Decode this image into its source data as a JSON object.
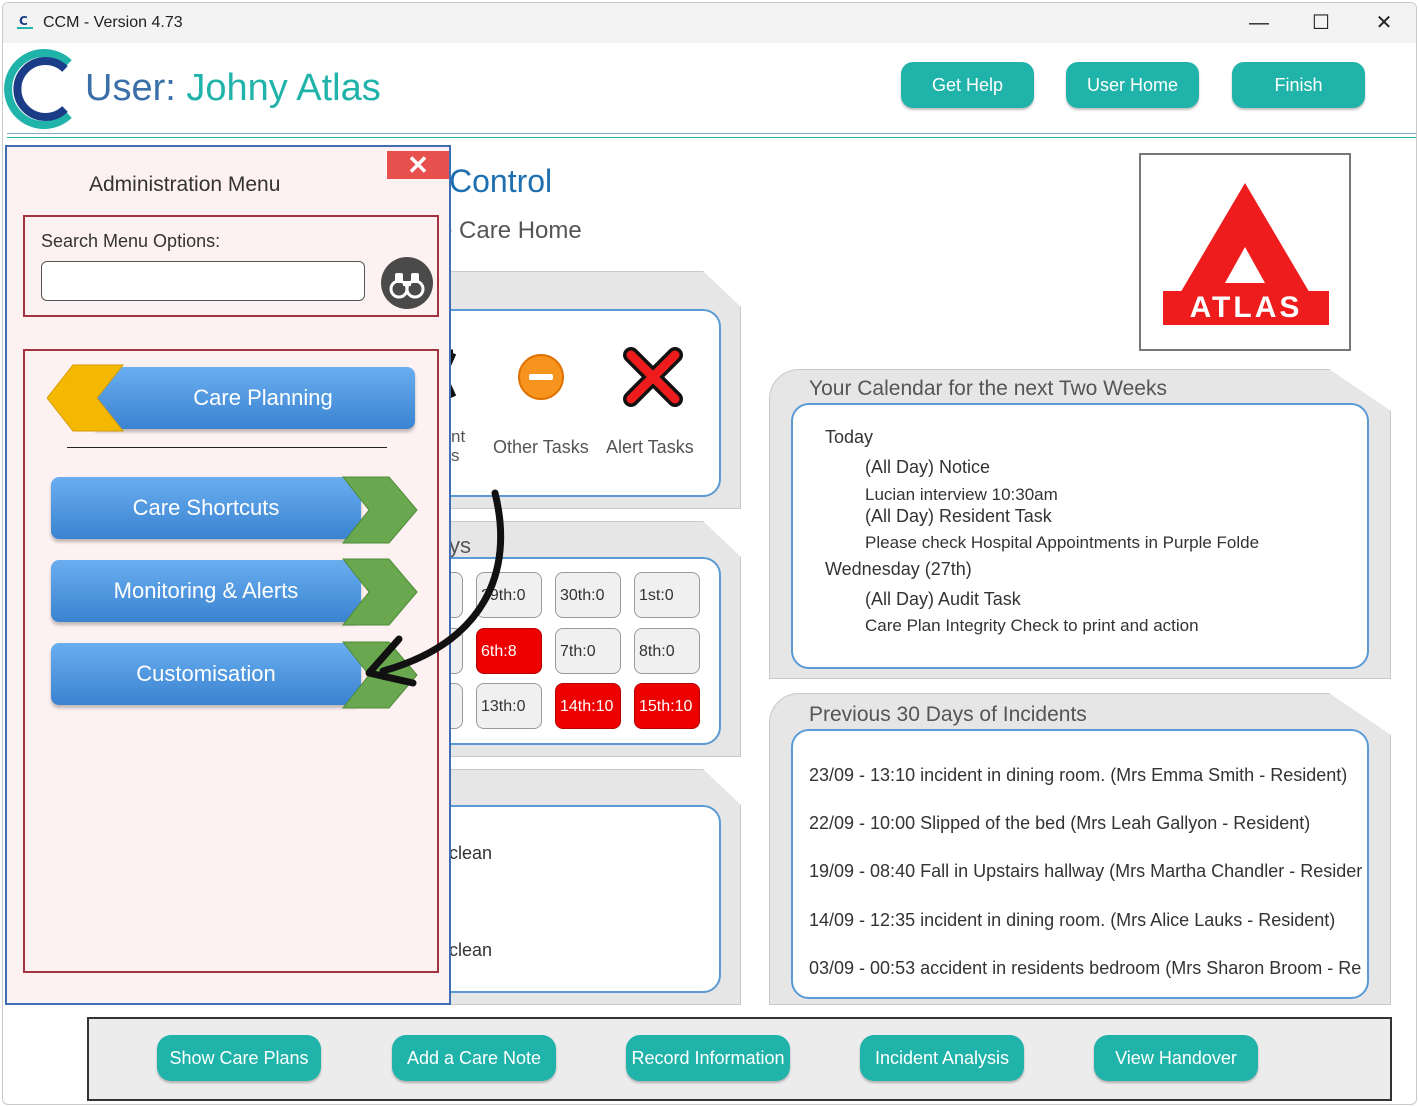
{
  "window": {
    "title": "CCM - Version 4.73",
    "minimize": "—",
    "maximize": "☐",
    "close": "✕"
  },
  "header": {
    "user_prefix": "User:",
    "user_name": "Johny Atlas",
    "buttons": [
      "Get Help",
      "User Home",
      "Finish"
    ]
  },
  "background_page": {
    "title_fragment": "Control",
    "subtitle_fragment": "e Care Home",
    "task_labels": {
      "partial_1": "nt",
      "partial_2": "s",
      "other": "Other Tasks",
      "alert": "Alert Tasks"
    },
    "days_fragment": "ys",
    "days": [
      {
        "label": "29th:0",
        "alert": false
      },
      {
        "label": "30th:0",
        "alert": false
      },
      {
        "label": "1st:0",
        "alert": false
      },
      {
        "label": "6th:8",
        "alert": true
      },
      {
        "label": "7th:0",
        "alert": false
      },
      {
        "label": "8th:0",
        "alert": false
      },
      {
        "label": "13th:0",
        "alert": false
      },
      {
        "label": "14th:10",
        "alert": true
      },
      {
        "label": "15th:10",
        "alert": true
      }
    ],
    "notes_fragments": [
      "clean",
      "clean"
    ]
  },
  "logo": {
    "text": "ATLAS",
    "color": "#ee1c1c"
  },
  "calendar": {
    "title": "Your Calendar for the next Two Weeks",
    "lines": [
      "Today",
      "(All Day) Notice",
      "Lucian interview 10:30am",
      "(All Day) Resident Task",
      "Please check Hospital Appointments in Purple Folde",
      "Wednesday (27th)",
      "(All Day) Audit Task",
      "Care Plan Integrity Check to print and action"
    ]
  },
  "incidents": {
    "title": "Previous 30 Days of Incidents",
    "items": [
      "23/09 - 13:10 incident in dining room. (Mrs Emma Smith - Resident)",
      "22/09 - 10:00 Slipped of the bed (Mrs Leah Gallyon - Resident)",
      "19/09 - 08:40 Fall in Upstairs hallway (Mrs Martha Chandler - Resider",
      "14/09 - 12:35 incident in dining room. (Mrs Alice Lauks - Resident)",
      "03/09 - 00:53 accident in residents bedroom (Mrs Sharon Broom - Re"
    ]
  },
  "admin_menu": {
    "title": "Administration Menu",
    "close": "✕",
    "search_label": "Search Menu Options:",
    "search_value": "",
    "items": [
      "Care Planning",
      "Care Shortcuts",
      "Monitoring & Alerts",
      "Customisation"
    ]
  },
  "bottom_bar": {
    "buttons": [
      "Show Care Plans",
      "Add a Care Note",
      "Record Information",
      "Incident Analysis",
      "View Handover"
    ]
  },
  "colors": {
    "teal": "#1fb3aa",
    "blue_button": "#4a90d9",
    "alert_red": "#ee0000",
    "arrow_yellow": "#f5b800",
    "arrow_green": "#6aa84f"
  }
}
